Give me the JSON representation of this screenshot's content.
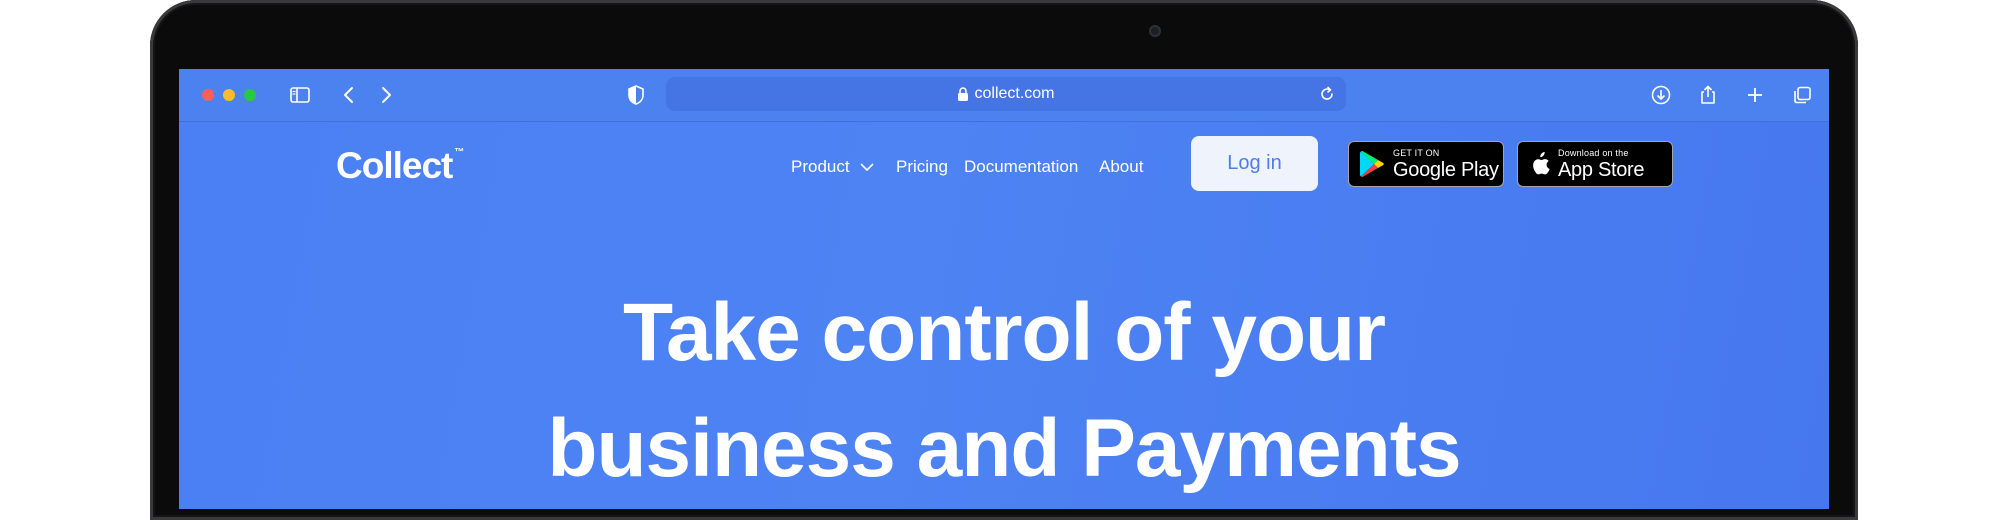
{
  "browser": {
    "url": "collect.com"
  },
  "site": {
    "logo": "Collect",
    "logo_tm": "™",
    "nav": {
      "product": "Product",
      "pricing": "Pricing",
      "documentation": "Documentation",
      "about": "About"
    },
    "login_label": "Log in",
    "google_play": {
      "small": "GET IT ON",
      "big": "Google Play"
    },
    "app_store": {
      "small": "Download on the",
      "big": "App Store"
    }
  },
  "hero": {
    "line1": "Take control of your",
    "line2": "business and Payments"
  },
  "colors": {
    "background": "#4a80f3",
    "login_text": "#4d7ee7",
    "login_bg": "#eef3fc"
  },
  "icons": [
    "sidebar-icon",
    "back-icon",
    "forward-icon",
    "shield-icon",
    "lock-icon",
    "reload-icon",
    "download-icon",
    "share-icon",
    "new-tab-icon",
    "tab-overview-icon",
    "chevron-down-icon",
    "google-play-icon",
    "apple-icon"
  ]
}
